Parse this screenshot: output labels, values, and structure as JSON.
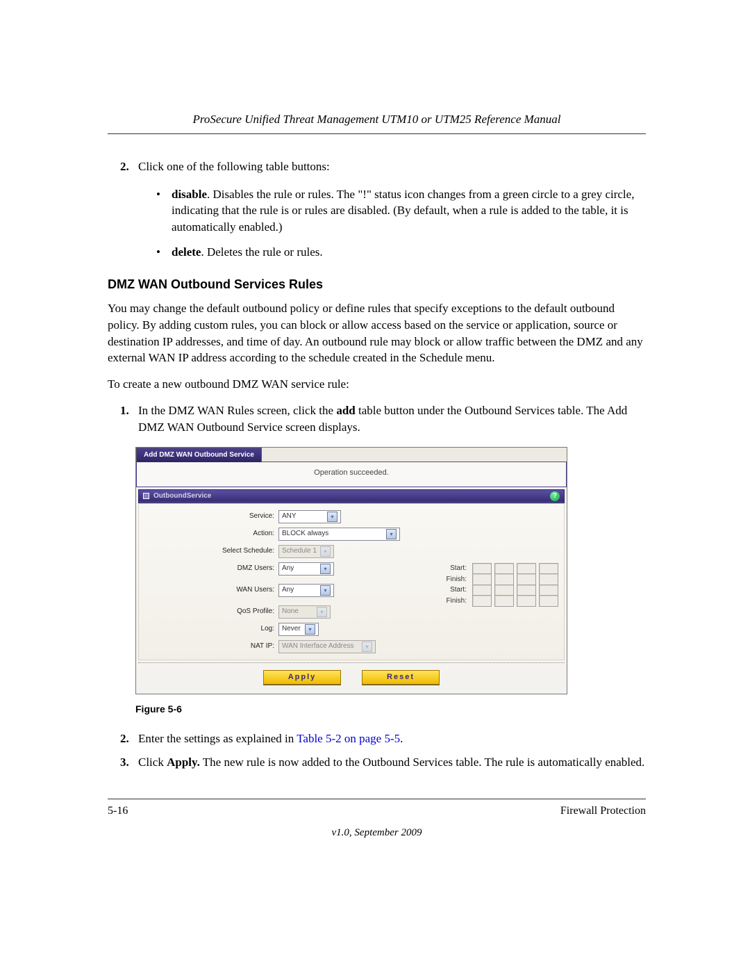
{
  "header": {
    "title": "ProSecure Unified Threat Management UTM10 or UTM25 Reference Manual"
  },
  "step2": {
    "num": "2.",
    "text": "Click one of the following table buttons:"
  },
  "bullets": [
    {
      "term": "disable",
      "desc": ". Disables the rule or rules. The \"!\" status icon changes from a green circle to a grey circle, indicating that the rule is or rules are disabled. (By default, when a rule is added to the table, it is automatically enabled.)"
    },
    {
      "term": "delete",
      "desc": ". Deletes the rule or rules."
    }
  ],
  "section_heading": "DMZ WAN Outbound Services Rules",
  "para1": "You may change the default outbound policy or define rules that specify exceptions to the default outbound policy. By adding custom rules, you can block or allow access based on the service or application, source or destination IP addresses, and time of day. An outbound rule may block or allow traffic between the DMZ and any external WAN IP address according to the schedule created in the Schedule menu.",
  "para2": "To create a new outbound DMZ WAN service rule:",
  "step1": {
    "num": "1.",
    "pre": "In the DMZ WAN Rules screen, click the ",
    "bold": "add",
    "post": " table button under the Outbound Services table. The Add DMZ WAN Outbound Service screen displays."
  },
  "shot": {
    "tab": "Add DMZ WAN Outbound Service",
    "status": "Operation succeeded.",
    "section": "OutboundService",
    "help": "?",
    "rows": {
      "service_lbl": "Service:",
      "service_val": "ANY",
      "action_lbl": "Action:",
      "action_val": "BLOCK always",
      "schedule_lbl": "Select Schedule:",
      "schedule_val": "Schedule 1",
      "dmz_lbl": "DMZ Users:",
      "dmz_val": "Any",
      "wan_lbl": "WAN Users:",
      "wan_val": "Any",
      "start_lbl": "Start:",
      "finish_lbl": "Finish:",
      "qos_lbl": "QoS Profile:",
      "qos_val": "None",
      "log_lbl": "Log:",
      "log_val": "Never",
      "nat_lbl": "NAT IP:",
      "nat_val": "WAN Interface Address"
    },
    "buttons": {
      "apply": "Apply",
      "reset": "Reset"
    }
  },
  "figure_caption": "Figure 5-6",
  "step2b": {
    "num": "2.",
    "pre": "Enter the settings as explained in ",
    "link": "Table 5-2 on page 5-5",
    "post": "."
  },
  "step3": {
    "num": "3.",
    "pre": "Click ",
    "bold": "Apply.",
    "post": " The new rule is now added to the Outbound Services table. The rule is automatically enabled."
  },
  "footer": {
    "left": "5-16",
    "right": "Firewall Protection",
    "version": "v1.0, September 2009"
  }
}
